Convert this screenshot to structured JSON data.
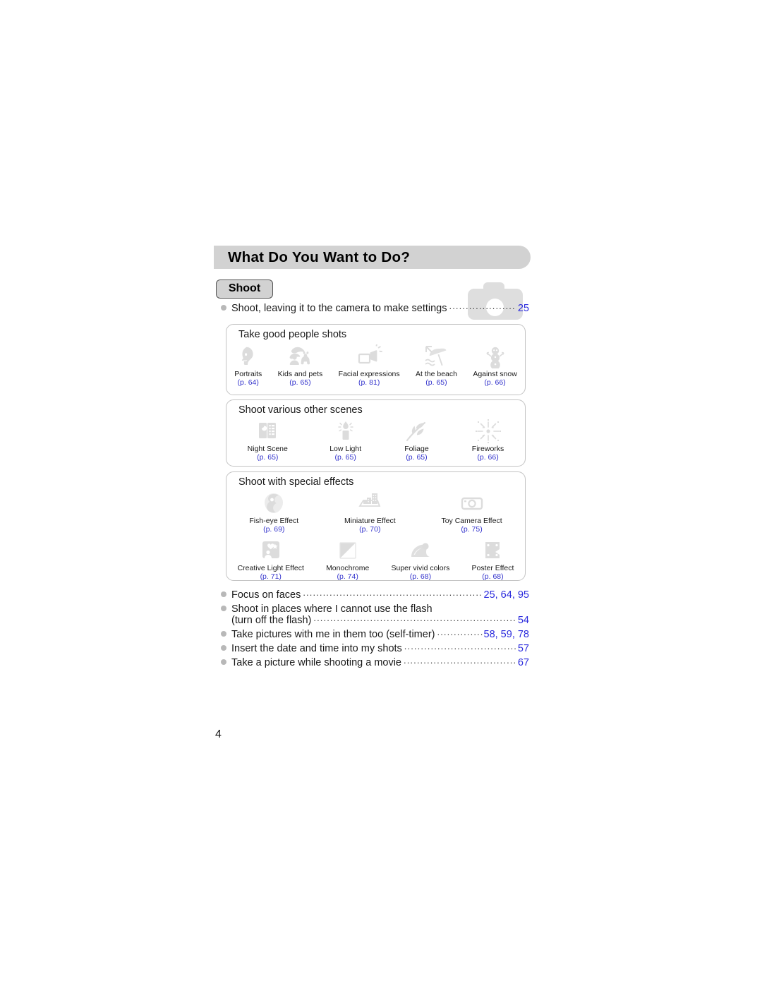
{
  "header": {
    "title": "What Do You Want to Do?",
    "badge_label": "Shoot",
    "camera_icon": "camera-watermark-icon"
  },
  "top_entry": {
    "bullet": "bullet-dot",
    "label": "Shoot, leaving it to the camera to make settings",
    "page": "25"
  },
  "groups": [
    {
      "title": "Take good people shots",
      "items": [
        {
          "icon": "portrait-face-icon",
          "label": "Portraits",
          "page": "(p. 64)"
        },
        {
          "icon": "kids-and-pets-icon",
          "label": "Kids and pets",
          "page": "(p. 65)"
        },
        {
          "icon": "facial-expressions-icon",
          "label": "Facial expressions",
          "page": "(p. 81)"
        },
        {
          "icon": "beach-umbrella-icon",
          "label": "At the beach",
          "page": "(p. 65)"
        },
        {
          "icon": "snowman-icon",
          "label": "Against snow",
          "page": "(p. 66)"
        }
      ]
    },
    {
      "title": "Shoot various other scenes",
      "items": [
        {
          "icon": "night-scene-icon",
          "label": "Night Scene",
          "page": "(p. 65)"
        },
        {
          "icon": "candle-low-light-icon",
          "label": "Low Light",
          "page": "(p. 65)"
        },
        {
          "icon": "foliage-leaf-icon",
          "label": "Foliage",
          "page": "(p. 65)"
        },
        {
          "icon": "fireworks-icon",
          "label": "Fireworks",
          "page": "(p. 66)"
        }
      ]
    },
    {
      "title": "Shoot with special effects",
      "row1": [
        {
          "icon": "fish-eye-icon",
          "label": "Fish-eye Effect",
          "page": "(p. 69)"
        },
        {
          "icon": "miniature-icon",
          "label": "Miniature Effect",
          "page": "(p. 70)"
        },
        {
          "icon": "toy-camera-icon",
          "label": "Toy Camera Effect",
          "page": "(p. 75)"
        }
      ],
      "row2": [
        {
          "icon": "creative-light-icon",
          "label": "Creative Light Effect",
          "page": "(p. 71)"
        },
        {
          "icon": "monochrome-icon",
          "label": "Monochrome",
          "page": "(p. 74)"
        },
        {
          "icon": "super-vivid-icon",
          "label": "Super vivid colors",
          "page": "(p. 68)"
        },
        {
          "icon": "poster-effect-icon",
          "label": "Poster Effect",
          "page": "(p. 68)"
        }
      ]
    }
  ],
  "bottom_list": [
    {
      "label": "Focus on faces",
      "page": "25, 64, 95"
    },
    {
      "label": "Shoot in places where I cannot use the flash",
      "label2": "(turn off the flash)",
      "page": "54"
    },
    {
      "label": "Take pictures with me in them too (self-timer)",
      "page": "58, 59, 78"
    },
    {
      "label": "Insert the date and time into my shots",
      "page": "57"
    },
    {
      "label": "Take a picture while shooting a movie",
      "page": "67"
    }
  ],
  "folio": "4",
  "colors": {
    "link_blue": "#2b2bdd",
    "page_ref_blue": "#3333cc",
    "bar_gray": "#d2d2d2",
    "icon_gray": "#dcdcdc",
    "box_border": "#c3c3c3"
  }
}
